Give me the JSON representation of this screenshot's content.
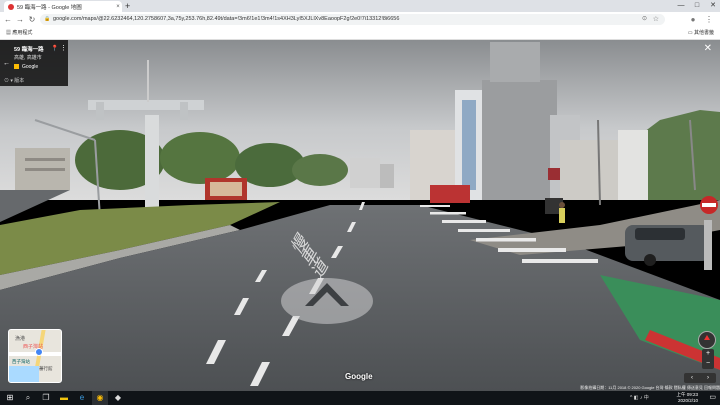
{
  "browser": {
    "tab_title": "59 臨海一路 - Google 地圖",
    "tab_close": "×",
    "new_tab": "+",
    "url": "google.com/maps/@22.6232464,120.2758607,3a,75y,253.76h,82.49t/data=!3m6!1e1!3m4!1s4XH3LyI5XJLlXv8EaoopF2g!2e0!7i13312!8i6656",
    "bookmarks_apps": "應用程式",
    "bookmarks_other": "其他書籤",
    "nav": {
      "back": "←",
      "forward": "→",
      "reload": "↻",
      "lock": "🔒",
      "star": "☆",
      "cast": "⊙"
    },
    "window": {
      "minimize": "—",
      "maximize": "□",
      "close": "✕",
      "menu": "⋮",
      "account": "●"
    }
  },
  "streetview": {
    "address_title": "59 臨海一路",
    "address_sub": "高雄, 高雄市",
    "provider": "Google",
    "date_label": "⊙ ▾ 版本",
    "close": "✕",
    "back_arrow": "←",
    "pin": "📍",
    "more": "⋮",
    "road_text": "慢車道",
    "google_logo": "Google",
    "footer": "影像拍攝日期：11月 2018   © 2020 Google   台灣   條款   隱私權   傳送意見   回報問題",
    "zoom_in": "+",
    "zoom_out": "−",
    "arrow_left": "‹",
    "arrow_right": "›"
  },
  "minimap": {
    "labels": [
      "漁港",
      "西子灣站",
      "西子灣站",
      "蕃行館"
    ]
  },
  "taskbar": {
    "start": "⊞",
    "search": "⌕",
    "taskview": "❐",
    "folder": "▬",
    "edge": "e",
    "chrome": "◉",
    "other": "◆",
    "tray": "^  ◧  ♪  中",
    "time": "上午 09:23",
    "date": "2020/2/10",
    "notification": "▭"
  },
  "colors": {
    "sky": "#c9cbcc",
    "road": "#5a5d60",
    "grass": "#7b8b48",
    "bike_lane": "#3a8e5a"
  }
}
